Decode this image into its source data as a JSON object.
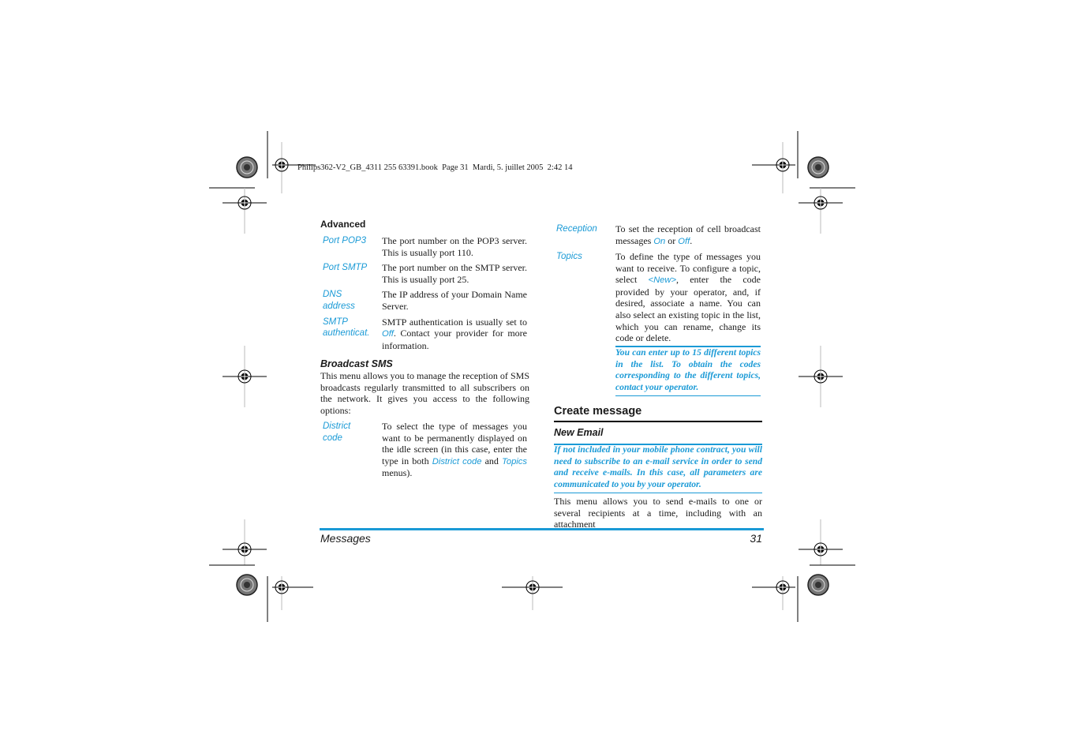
{
  "print_header": "Philips362-V2_GB_4311 255 63391.book  Page 31  Mardi, 5. juillet 2005  2:42 14",
  "left_column": {
    "advanced_heading": "Advanced",
    "advanced_items": [
      {
        "term": [
          "Port POP3"
        ],
        "desc": "The port number on the POP3 server. This is usually port 110."
      },
      {
        "term": [
          "Port SMTP"
        ],
        "desc": "The port number on the SMTP server. This is usually port 25."
      },
      {
        "term": [
          "DNS",
          "address"
        ],
        "desc": "The IP address of your Domain Name Server."
      },
      {
        "term": [
          "SMTP",
          "authenticat."
        ],
        "desc_pre": "SMTP authentication is usually set to ",
        "desc_link": "Off",
        "desc_post": ". Contact your provider for more information."
      }
    ],
    "broadcast_heading": "Broadcast SMS",
    "broadcast_intro": "This menu allows you to manage the reception of SMS broadcasts regularly transmitted to all subscribers on the network. It gives you access to the following options:",
    "district": {
      "term": [
        "District",
        "code"
      ],
      "desc_pre": "To select the type of messages you want to be permanently displayed on the idle screen (in this case, enter the type in both ",
      "link1": "District code",
      "mid": " and ",
      "link2": "Topics",
      "desc_post": " menus)."
    }
  },
  "right_column": {
    "reception": {
      "term": "Reception",
      "desc_pre": "To set the reception of cell broadcast messages ",
      "on": "On",
      "or": " or ",
      "off": "Off",
      "end": "."
    },
    "topics": {
      "term": "Topics",
      "desc_pre": "To define the type of messages you want to receive. To configure a topic, select ",
      "new": "<New>",
      "desc_post": ", enter the code provided by your operator, and, if desired, associate a name. You can also select an existing topic in the list, which you can rename, change its code or delete."
    },
    "topics_note": "You can enter up to 15 different topics in the list. To obtain the codes corresponding to the different topics, contact your operator.",
    "create_heading": "Create message",
    "new_email_heading": "New Email",
    "email_note": "If not included in your mobile phone contract, you will need to subscribe to an e-mail service in order to send and receive e-mails. In this case, all parameters are communicated to you by your operator.",
    "email_body": "This menu allows you to send e-mails to one or several recipients at a time, including with an attachment"
  },
  "footer": {
    "section": "Messages",
    "page_number": "31"
  }
}
